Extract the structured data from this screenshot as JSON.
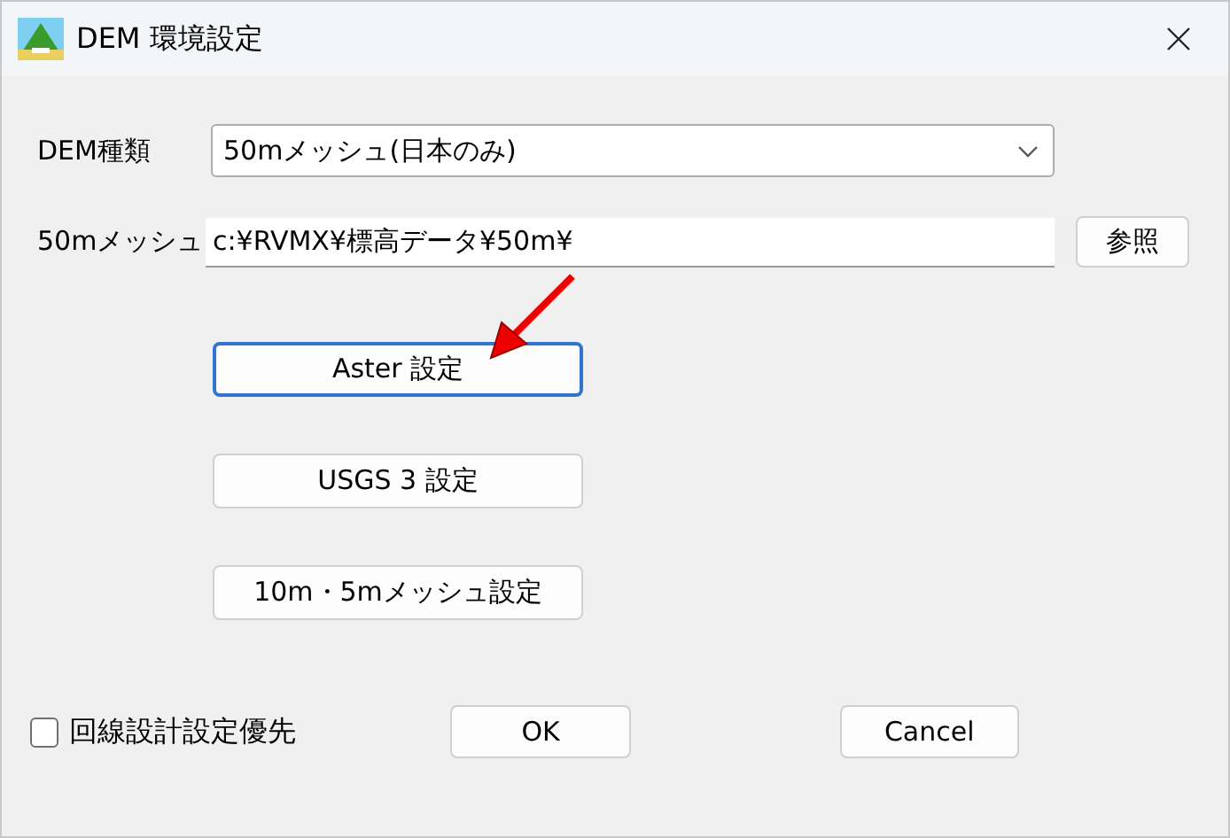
{
  "window": {
    "title": "DEM 環境設定"
  },
  "dem_type": {
    "label": "DEM種類",
    "value": "50mメッシュ(日本のみ)"
  },
  "mesh_50m": {
    "label": "50mメッシュ",
    "value": "c:¥RVMX¥標高データ¥50m¥",
    "browse": "参照"
  },
  "setting_buttons": [
    {
      "label": "Aster 設定",
      "focused": true
    },
    {
      "label": "USGS 3 設定",
      "focused": false
    },
    {
      "label": "10m・5mメッシュ設定",
      "focused": false
    }
  ],
  "priority_checkbox": {
    "label": "回線設計設定優先",
    "checked": false
  },
  "buttons": [
    "OK",
    "Cancel"
  ]
}
